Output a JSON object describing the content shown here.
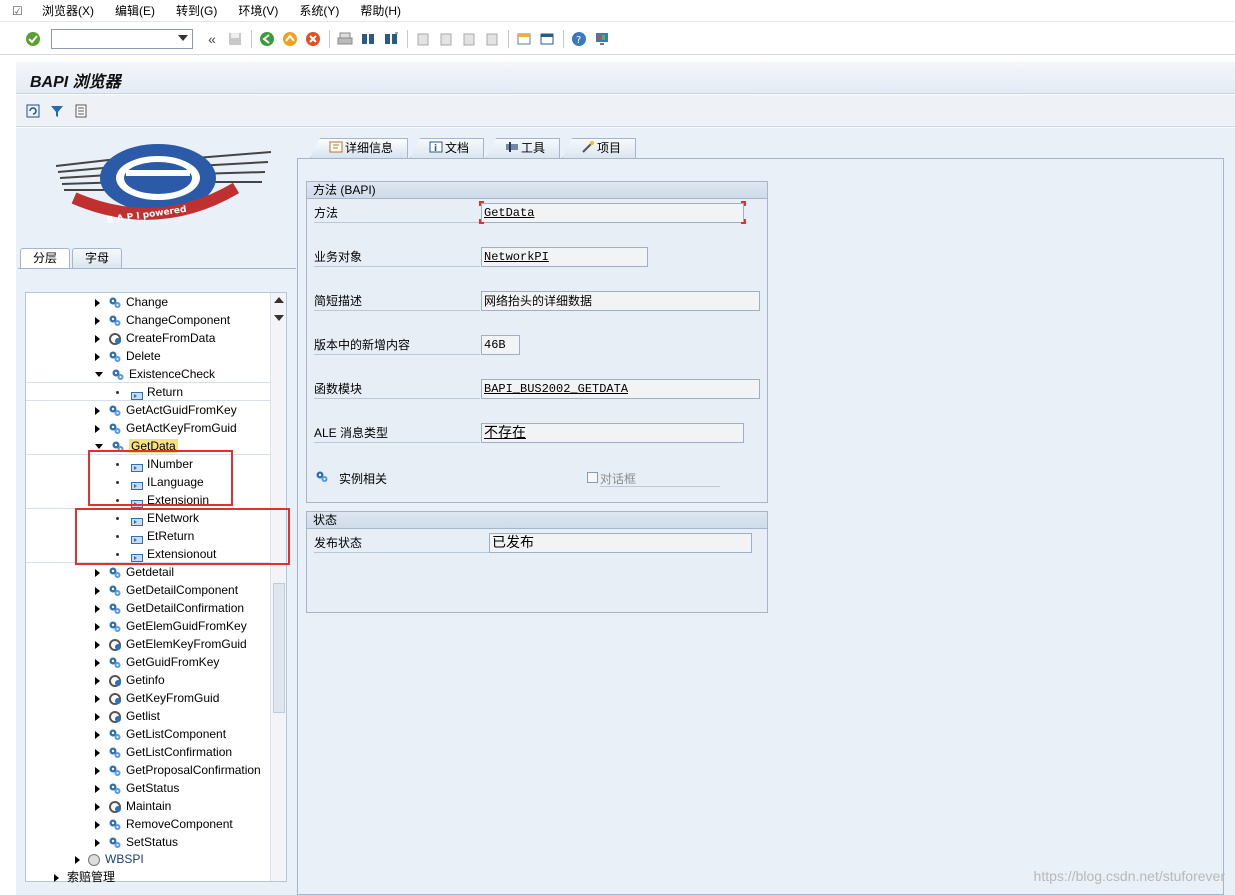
{
  "menubar": {
    "items": [
      "浏览器(X)",
      "编辑(E)",
      "转到(G)",
      "环境(V)",
      "系统(Y)",
      "帮助(H)"
    ]
  },
  "toolbar": {
    "command_field_value": ""
  },
  "title": "BAPI 浏览器",
  "left_tabs": [
    "分层",
    "字母"
  ],
  "tree": {
    "rows": [
      {
        "label": "Change",
        "type": "method",
        "expand": "collapsed",
        "indent": 1
      },
      {
        "label": "ChangeComponent",
        "type": "method",
        "expand": "collapsed",
        "indent": 1
      },
      {
        "label": "CreateFromData",
        "type": "method",
        "expand": "collapsed",
        "indent": 1
      },
      {
        "label": "Delete",
        "type": "method",
        "expand": "collapsed",
        "indent": 1
      },
      {
        "label": "ExistenceCheck",
        "type": "method",
        "expand": "expanded",
        "indent": 1
      },
      {
        "label": "Return",
        "type": "param",
        "indent": 2
      },
      {
        "label": "GetActGuidFromKey",
        "type": "method",
        "expand": "collapsed",
        "indent": 1
      },
      {
        "label": "GetActKeyFromGuid",
        "type": "method",
        "expand": "collapsed",
        "indent": 1
      },
      {
        "label": "GetData",
        "type": "method",
        "expand": "expanded",
        "indent": 1,
        "selected": true
      },
      {
        "label": "INumber",
        "type": "param",
        "indent": 2
      },
      {
        "label": "ILanguage",
        "type": "param",
        "indent": 2
      },
      {
        "label": "Extensionin",
        "type": "param",
        "indent": 2
      },
      {
        "label": "ENetwork",
        "type": "param",
        "indent": 2
      },
      {
        "label": "EtReturn",
        "type": "param",
        "indent": 2
      },
      {
        "label": "Extensionout",
        "type": "param",
        "indent": 2
      },
      {
        "label": "Getdetail",
        "type": "method",
        "expand": "collapsed",
        "indent": 1
      },
      {
        "label": "GetDetailComponent",
        "type": "method",
        "expand": "collapsed",
        "indent": 1
      },
      {
        "label": "GetDetailConfirmation",
        "type": "method",
        "expand": "collapsed",
        "indent": 1
      },
      {
        "label": "GetElemGuidFromKey",
        "type": "method",
        "expand": "collapsed",
        "indent": 1
      },
      {
        "label": "GetElemKeyFromGuid",
        "type": "method",
        "expand": "collapsed",
        "indent": 1
      },
      {
        "label": "GetGuidFromKey",
        "type": "method",
        "expand": "collapsed",
        "indent": 1
      },
      {
        "label": "Getinfo",
        "type": "method",
        "expand": "collapsed",
        "indent": 1
      },
      {
        "label": "GetKeyFromGuid",
        "type": "method",
        "expand": "collapsed",
        "indent": 1
      },
      {
        "label": "Getlist",
        "type": "method",
        "expand": "collapsed",
        "indent": 1
      },
      {
        "label": "GetListComponent",
        "type": "method",
        "expand": "collapsed",
        "indent": 1
      },
      {
        "label": "GetListConfirmation",
        "type": "method",
        "expand": "collapsed",
        "indent": 1
      },
      {
        "label": "GetProposalConfirmation",
        "type": "method",
        "expand": "collapsed",
        "indent": 1
      },
      {
        "label": "GetStatus",
        "type": "method",
        "expand": "collapsed",
        "indent": 1
      },
      {
        "label": "Maintain",
        "type": "method",
        "expand": "collapsed",
        "indent": 1
      },
      {
        "label": "RemoveComponent",
        "type": "method",
        "expand": "collapsed",
        "indent": 1
      },
      {
        "label": "SetStatus",
        "type": "method",
        "expand": "collapsed",
        "indent": 1
      }
    ],
    "bottom_rows": [
      {
        "label": "WBSPI",
        "type": "object"
      },
      {
        "label": "索赔管理",
        "type": "folder"
      }
    ]
  },
  "right_tabs": [
    "详细信息",
    "文档",
    "工具",
    "项目"
  ],
  "method_group": {
    "title": "方法 (BAPI)",
    "fields": [
      {
        "label": "方法",
        "value": "GetData"
      },
      {
        "label": "业务对象",
        "value": "NetworkPI"
      },
      {
        "label": "简短描述",
        "value": "网络抬头的详细数据"
      },
      {
        "label": "版本中的新增内容",
        "value": "46B"
      },
      {
        "label": "函数模块",
        "value": "BAPI_BUS2002_GETDATA"
      },
      {
        "label": "ALE 消息类型",
        "value": "不存在"
      }
    ],
    "instance_label": "实例相关",
    "dialog_checkbox_label": "对话框",
    "dialog_checked": false
  },
  "status_group": {
    "title": "状态",
    "label": "发布状态",
    "value": "已发布"
  },
  "watermark": "https://blog.csdn.net/stuforever"
}
